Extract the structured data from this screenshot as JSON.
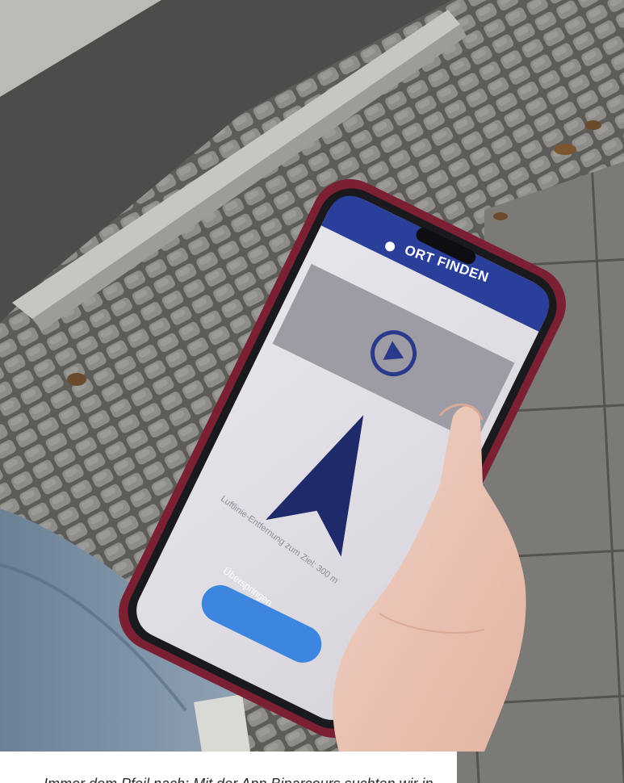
{
  "app": {
    "title": "ORT FINDEN",
    "hint_text": "Luftlinie-Entfernung zum Ziel: 300 m",
    "skip_button_label": "Überspringen"
  },
  "caption": {
    "text": "Immer dem Pfeil nach: Mit der App Biparcours suchten wir in"
  },
  "colors": {
    "phone_case": "#7b1f33",
    "arrow": "#1f2a6b",
    "button": "#3d86e0",
    "header": "#2a3f9a"
  }
}
